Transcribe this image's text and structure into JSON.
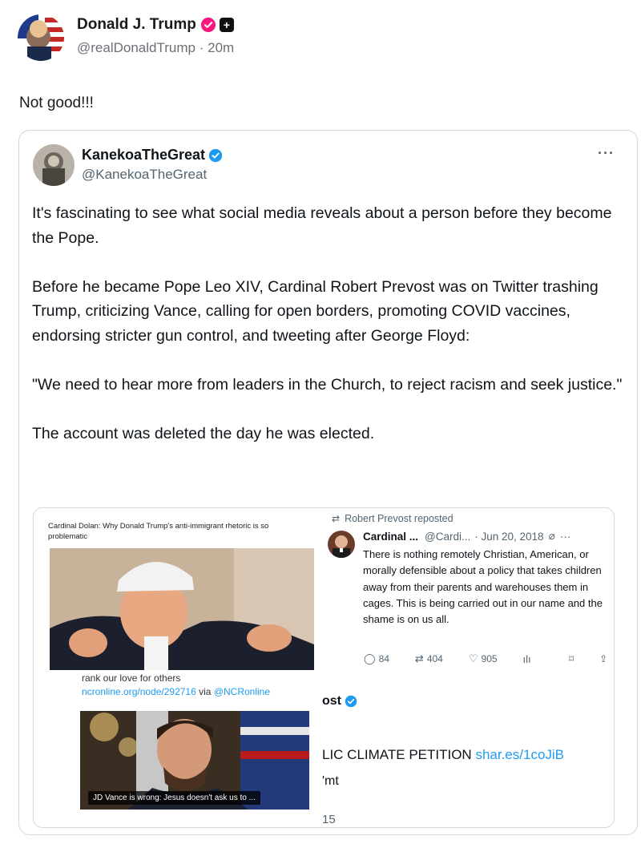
{
  "post": {
    "author_name": "Donald J. Trump",
    "handle": "@realDonaldTrump",
    "separator": "·",
    "time": "20m",
    "text": "Not good!!!",
    "colors": {
      "verified_badge": "#f91880",
      "text": "#1a1a1a",
      "secondary": "#6b7075"
    },
    "icons": [
      "verified-badge-icon",
      "plus-badge-icon"
    ]
  },
  "quote": {
    "author_name": "KanekoaTheGreat",
    "handle": "@KanekoaTheGreat",
    "more_label": "···",
    "paragraphs": [
      "It's fascinating to see what social media reveals about a person before they become the Pope.",
      "Before he became Pope Leo XIV, Cardinal Robert Prevost was on Twitter trashing Trump, criticizing Vance, calling for open borders, promoting COVID vaccines, endorsing stricter gun control, and tweeting after George Floyd:",
      "\"We need to hear more from leaders in the Church, to reject racism and seek justice.\"",
      "The account was deleted the day he was elected."
    ],
    "colors": {
      "verified_badge": "#1d9bf0",
      "border": "#cfd9de"
    }
  },
  "media": {
    "left": {
      "dolan_title": "Cardinal Dolan: Why Donald Trump's anti-immigrant rhetoric is so problematic",
      "caption": "rank our love for others",
      "link_url": "ncronline.org/node/292716",
      "link_via": "via",
      "link_handle": "@NCRonline",
      "vance_caption": "JD Vance is wrong: Jesus doesn't ask us to ..."
    },
    "right": {
      "repost_label": "Robert Prevost reposted",
      "tweet_name": "Cardinal ...",
      "tweet_handle": "@Cardi...",
      "tweet_date": "· Jun 20, 2018",
      "tweet_text": "There is nothing remotely Christian, American, or morally defensible about a policy that takes children away from their parents and warehouses them in cages. This is being carried out in our name and the shame is on us all.",
      "replies": "84",
      "reposts": "404",
      "likes": "905",
      "other_name": "ost",
      "petition_text": "LIC CLIMATE PETITION",
      "petition_url": "shar.es/1coJiB",
      "mt_text": "'mt",
      "count_15": "15"
    }
  }
}
